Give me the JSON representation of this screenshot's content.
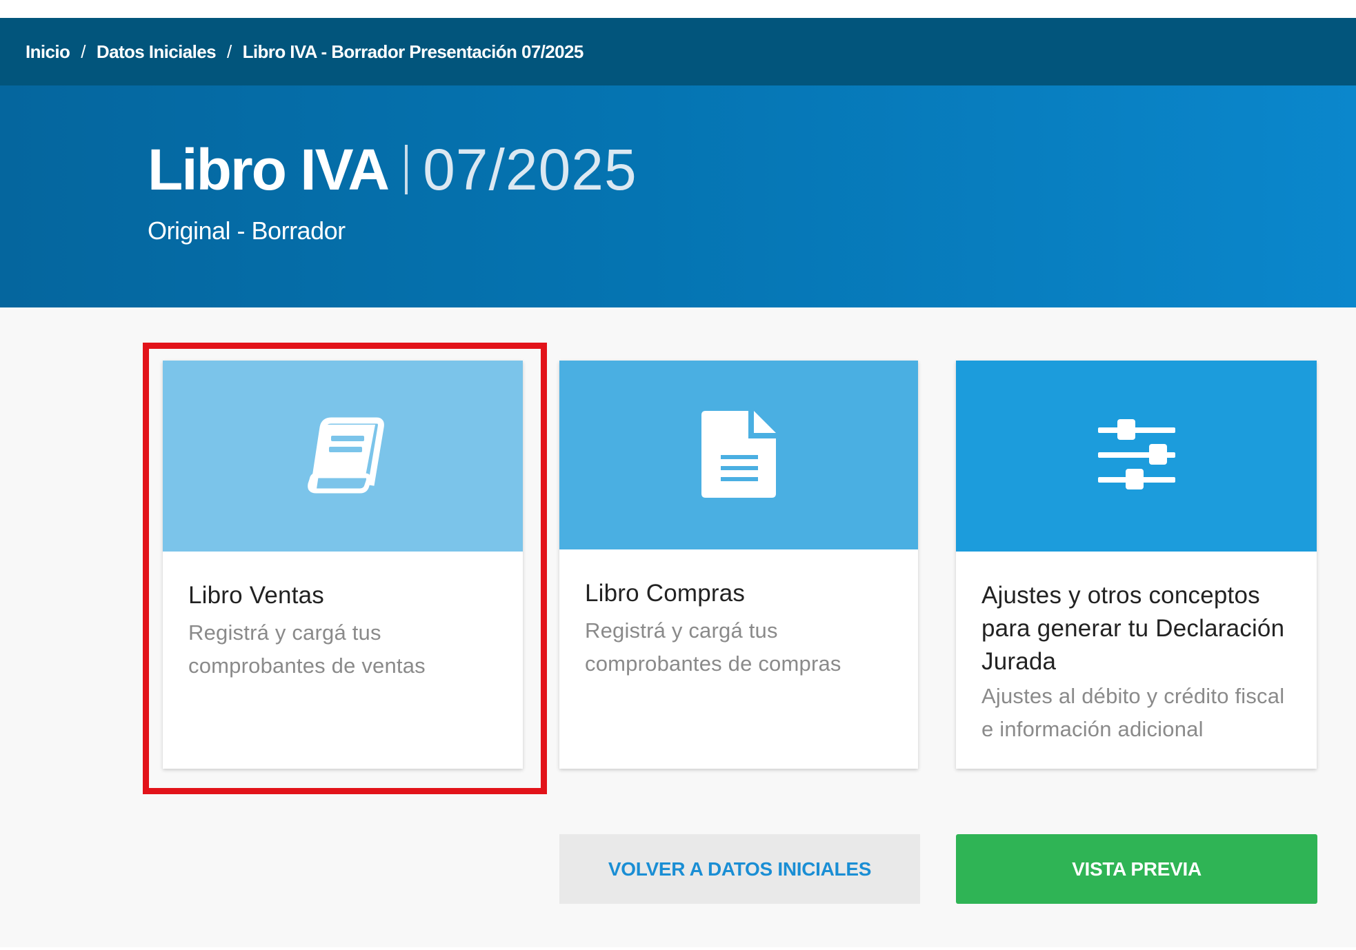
{
  "breadcrumb": {
    "items": [
      "Inicio",
      "Datos Iniciales",
      "Libro IVA - Borrador Presentación 07/2025"
    ],
    "separator": "/"
  },
  "header": {
    "title": "Libro IVA",
    "period": "07/2025",
    "subtitle": "Original - Borrador"
  },
  "cards": [
    {
      "title": "Libro Ventas",
      "description": "Registrá y cargá tus comprobantes de ventas",
      "icon": "book-icon",
      "highlighted": true
    },
    {
      "title": "Libro Compras",
      "description": "Registrá y cargá tus comprobantes de compras",
      "icon": "document-icon"
    },
    {
      "title": "Ajustes y otros conceptos para generar tu Declaración Jurada",
      "description": "Ajustes al débito y crédito fiscal e información adicional",
      "icon": "sliders-icon"
    }
  ],
  "buttons": {
    "back_label": "VOLVER A DATOS INICIALES",
    "preview_label": "VISTA PREVIA"
  },
  "colors": {
    "breadcrumb_bg": "#02557c",
    "hero_bg": "#0575b3",
    "card_ventas_head": "#7bc4ea",
    "card_compras_head": "#4aafe2",
    "card_ajustes_head": "#1c9cdc",
    "highlight_border": "#e2131a",
    "primary_button": "#2fb455",
    "link_text": "#1a8ed4"
  }
}
